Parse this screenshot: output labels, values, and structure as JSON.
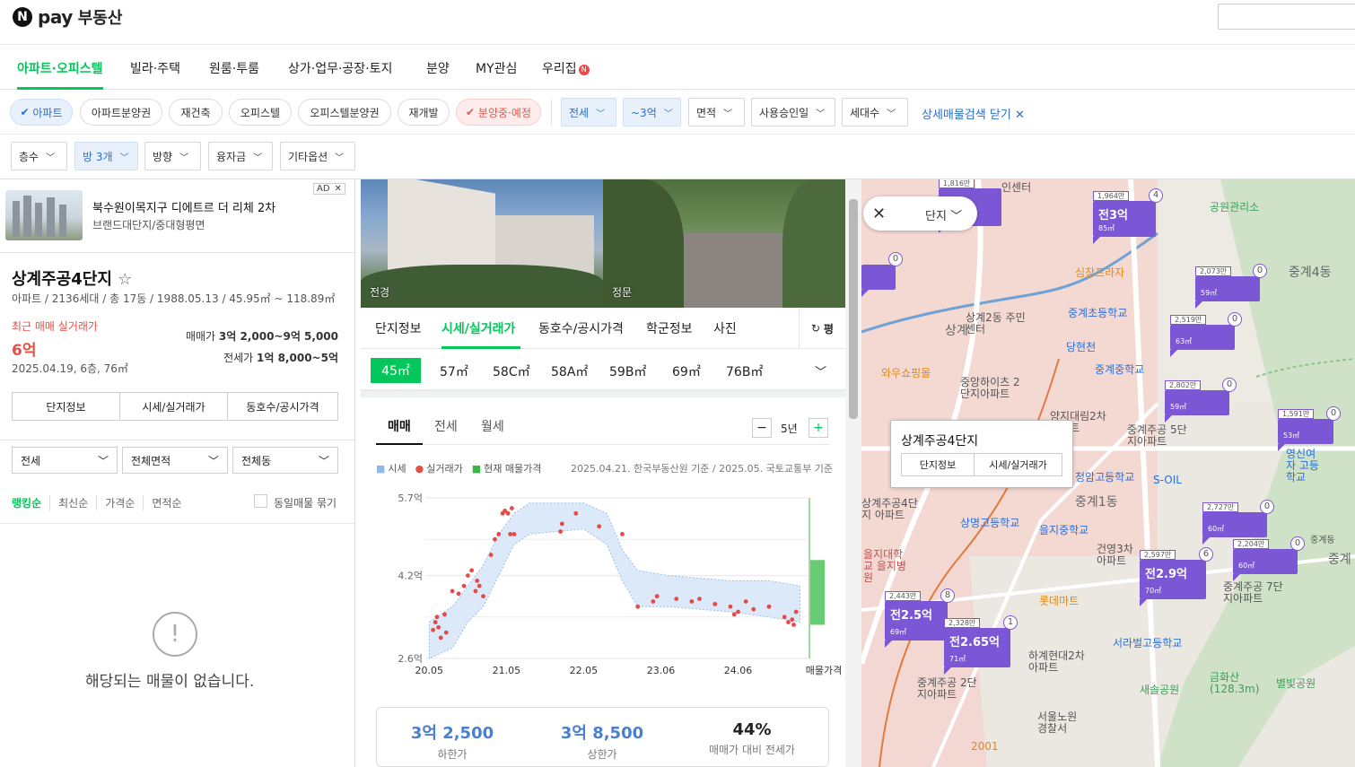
{
  "header": {
    "brand_pay": "pay",
    "brand_name": "부동산"
  },
  "nav": [
    "아파트·오피스텔",
    "빌라·주택",
    "원룸·투룸",
    "상가·업무·공장·토지",
    "분양",
    "MY관심",
    "우리집"
  ],
  "nav_badge": "N",
  "filters1": {
    "chips": [
      "아파트",
      "아파트분양권",
      "재건축",
      "오피스텔",
      "오피스텔분양권",
      "재개발",
      "분양중·예정"
    ],
    "selects": [
      "전세",
      "~3억",
      "면적",
      "사용승인일",
      "세대수"
    ],
    "close_label": "상세매물검색 닫기"
  },
  "filters2": [
    "층수",
    "방 3개",
    "방향",
    "융자금",
    "기타옵션"
  ],
  "ad": {
    "title": "북수원이목지구 디에트르 더 리체 2차",
    "subtitle": "브랜드대단지/중대형평면",
    "tag": "AD"
  },
  "complex": {
    "name": "상계주공4단지",
    "info": "아파트 / 2136세대 / 총 17동 / 1988.05.13 / 45.95㎡ ~ 118.89㎡",
    "recent_label": "최근 매매 실거래가",
    "recent_value": "6억",
    "recent_date": "2025.04.19, 6층, 76㎡",
    "sale_label": "매매가",
    "sale_range": "3억 2,000~9억 5,000",
    "jeonse_label": "전세가",
    "jeonse_range": "1억 8,000~5억",
    "buttons": [
      "단지정보",
      "시세/실거래가",
      "동호수/공시가격"
    ]
  },
  "list_filters": [
    "전세",
    "전체면적",
    "전체동"
  ],
  "sort": [
    "랭킹순",
    "최신순",
    "가격순",
    "면적순"
  ],
  "same_listing": "동일매물 묶기",
  "empty_message": "해당되는 매물이 없습니다.",
  "photos": [
    "전경",
    "정문"
  ],
  "center_tabs": [
    "단지정보",
    "시세/실거래가",
    "동호수/공시가격",
    "학군정보",
    "사진"
  ],
  "pyeong_label": "평",
  "sizes": [
    "45㎡",
    "57㎡",
    "58C㎡",
    "58A㎡",
    "59B㎡",
    "69㎡",
    "76B㎡"
  ],
  "trade_tabs": [
    "매매",
    "전세",
    "월세"
  ],
  "period": "5년",
  "legend": [
    "시세",
    "실거래가",
    "현재 매물가격"
  ],
  "basis": "2025.04.21. 한국부동산원 기준 / 2025.05. 국토교통부 기준",
  "stats": [
    {
      "value": "3억 2,500",
      "label": "하한가"
    },
    {
      "value": "3억 8,500",
      "label": "상한가"
    },
    {
      "value": "44%",
      "label": "매매가 대비 전세가"
    }
  ],
  "chart_data": {
    "type": "scatter",
    "title": "",
    "xlabel": "",
    "ylabel": "",
    "x_ticks": [
      "20.05",
      "21.05",
      "22.05",
      "23.06",
      "24.06",
      "매물가격"
    ],
    "y_ticks": [
      "5.7억",
      "4.2억",
      "2.6억"
    ],
    "ylim": [
      2.6,
      5.7
    ],
    "series": [
      {
        "name": "시세",
        "band": [
          {
            "x": 2020.4,
            "low": 2.6,
            "high": 3.3
          },
          {
            "x": 2020.7,
            "low": 2.8,
            "high": 3.6
          },
          {
            "x": 2020.9,
            "low": 3.3,
            "high": 4.0
          },
          {
            "x": 2021.1,
            "low": 3.6,
            "high": 4.4
          },
          {
            "x": 2021.3,
            "low": 4.2,
            "high": 5.0
          },
          {
            "x": 2021.5,
            "low": 4.8,
            "high": 5.4
          },
          {
            "x": 2021.7,
            "low": 5.0,
            "high": 5.6
          },
          {
            "x": 2022.4,
            "low": 5.1,
            "high": 5.6
          },
          {
            "x": 2022.7,
            "low": 4.8,
            "high": 5.4
          },
          {
            "x": 2022.9,
            "low": 4.1,
            "high": 4.7
          },
          {
            "x": 2023.1,
            "low": 3.6,
            "high": 4.3
          },
          {
            "x": 2023.5,
            "low": 3.6,
            "high": 4.2
          },
          {
            "x": 2024.3,
            "low": 3.5,
            "high": 4.1
          },
          {
            "x": 2024.8,
            "low": 3.4,
            "high": 4.1
          },
          {
            "x": 2025.2,
            "low": 3.3,
            "high": 4.0
          }
        ]
      },
      {
        "name": "실거래가",
        "points": [
          [
            2020.45,
            3.15
          ],
          [
            2020.48,
            3.3
          ],
          [
            2020.5,
            3.4
          ],
          [
            2020.52,
            3.2
          ],
          [
            2020.55,
            3.0
          ],
          [
            2020.6,
            3.45
          ],
          [
            2020.62,
            3.1
          ],
          [
            2020.7,
            3.9
          ],
          [
            2020.78,
            3.85
          ],
          [
            2020.85,
            4.0
          ],
          [
            2020.9,
            4.2
          ],
          [
            2020.95,
            4.3
          ],
          [
            2021.0,
            3.9
          ],
          [
            2021.02,
            4.1
          ],
          [
            2021.05,
            4.0
          ],
          [
            2021.1,
            3.8
          ],
          [
            2021.2,
            4.6
          ],
          [
            2021.25,
            4.9
          ],
          [
            2021.3,
            5.0
          ],
          [
            2021.35,
            5.4
          ],
          [
            2021.38,
            5.45
          ],
          [
            2021.42,
            5.4
          ],
          [
            2021.45,
            5.0
          ],
          [
            2021.47,
            5.5
          ],
          [
            2021.5,
            5.0
          ],
          [
            2022.1,
            5.05
          ],
          [
            2022.12,
            5.2
          ],
          [
            2022.3,
            5.4
          ],
          [
            2022.6,
            5.15
          ],
          [
            2022.9,
            5.0
          ],
          [
            2023.1,
            3.6
          ],
          [
            2023.3,
            3.7
          ],
          [
            2023.35,
            3.8
          ],
          [
            2023.6,
            3.75
          ],
          [
            2023.8,
            3.7
          ],
          [
            2023.9,
            3.75
          ],
          [
            2024.1,
            3.65
          ],
          [
            2024.3,
            3.6
          ],
          [
            2024.35,
            3.45
          ],
          [
            2024.4,
            3.5
          ],
          [
            2024.5,
            3.7
          ],
          [
            2024.6,
            3.55
          ],
          [
            2024.8,
            3.6
          ],
          [
            2025.0,
            3.4
          ],
          [
            2025.05,
            3.3
          ],
          [
            2025.1,
            3.35
          ],
          [
            2025.12,
            3.25
          ],
          [
            2025.15,
            3.5
          ]
        ]
      },
      {
        "name": "현재 매물가격",
        "range": [
          3.25,
          4.5
        ]
      }
    ]
  },
  "map": {
    "filter_label": "단지",
    "popup_title": "상계주공4단지",
    "popup_buttons": [
      "단지정보",
      "시세/실거래가"
    ],
    "labels": [
      "중계4동",
      "상계2동 주민센터",
      "상계",
      "중계1동",
      "중계주공 7단지아파트",
      "와우쇼핑몰",
      "중앙하이츠 2단지아파트",
      "당현천",
      "중계초등학교",
      "중계중학교",
      "청암고등학교",
      "S-OIL",
      "을지중학교",
      "상명고등학교",
      "건영3차 아파트",
      "롯데마트",
      "서라벌고등학교",
      "하계현대2차 아파트",
      "서울노원 경찰서",
      "새솔공원",
      "금화산 (128.3m)",
      "별빛공원",
      "영신여자 고등학교",
      "심창프라자",
      "양지대림2차 아파트",
      "중계주공 5단지아파트",
      "공원관리소",
      "상계주공4단지 아파트",
      "중계주공 2단지아파트",
      "을지대학교 을지병원",
      "인센터",
      "2001",
      "중계",
      "중계동"
    ],
    "pins": [
      {
        "price": "전3억",
        "area": "85㎡",
        "unit": "1,964만",
        "count": "4"
      },
      {
        "price": "",
        "area": "59㎡",
        "unit": "2,073만",
        "count": "0"
      },
      {
        "price": "",
        "area": "63㎡",
        "unit": "2,519만",
        "count": "0"
      },
      {
        "price": "",
        "area": "59㎡",
        "unit": "2,802만",
        "count": "0"
      },
      {
        "price": "",
        "area": "53㎡",
        "unit": "1,591만",
        "count": "0"
      },
      {
        "price": "",
        "area": "60㎡",
        "unit": "2,727만",
        "count": "0"
      },
      {
        "price": "",
        "area": "60㎡",
        "unit": "2,204만",
        "count": "0"
      },
      {
        "price": "전2.9억",
        "area": "70㎡",
        "unit": "2,597만",
        "count": "6"
      },
      {
        "price": "전2.5억",
        "area": "69㎡",
        "unit": "2,443만",
        "count": "8"
      },
      {
        "price": "전2.65억",
        "area": "71㎡",
        "unit": "2,328만",
        "count": "1"
      },
      {
        "price": "",
        "area": "",
        "unit": "1,816만",
        "count": ""
      },
      {
        "price": "",
        "area": "",
        "unit": "",
        "count": "0"
      }
    ]
  },
  "colors": {
    "accent": "#03c75a",
    "blue": "#2c6ecb",
    "red": "#e25148",
    "pin": "#7b57d6"
  }
}
